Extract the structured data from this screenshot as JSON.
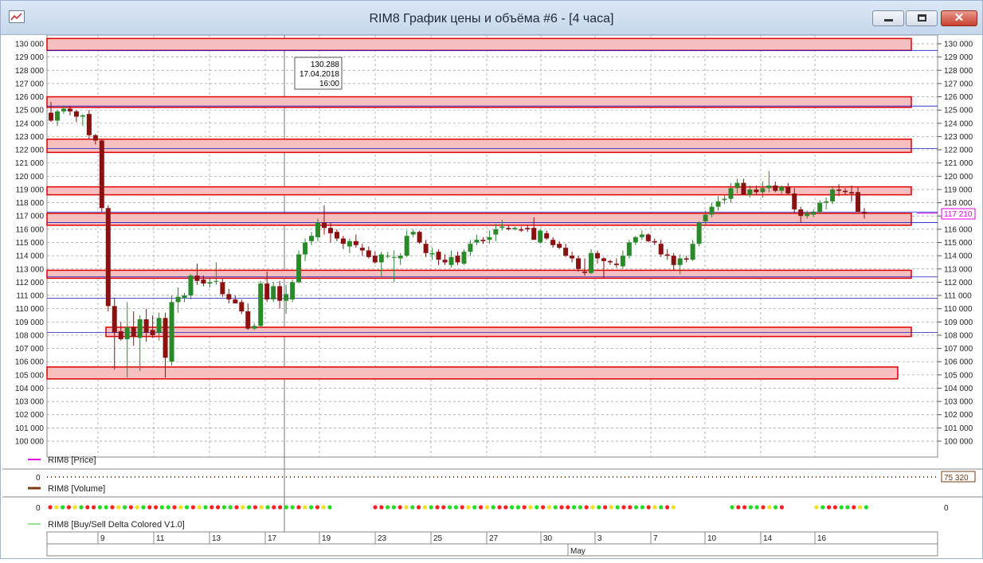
{
  "window": {
    "title": "RIM8 График цены и объёма #6 - [4 часа]",
    "buttons": [
      "minimize",
      "maximize",
      "close"
    ]
  },
  "price_panel": {
    "legend_label": "RIM8 [Price]",
    "y_ticks": [
      "130 000",
      "129 000",
      "128 000",
      "127 000",
      "126 000",
      "125 000",
      "124 000",
      "123 000",
      "122 000",
      "121 000",
      "120 000",
      "119 000",
      "118 000",
      "117 000",
      "116 000",
      "115 000",
      "114 000",
      "113 000",
      "112 000",
      "111 000",
      "110 000",
      "109 000",
      "108 000",
      "107 000",
      "106 000",
      "105 000",
      "104 000",
      "103 000",
      "102 000",
      "101 000",
      "100 000"
    ],
    "current_price_label": "117 210",
    "cursor_tooltip": {
      "price": "130.288",
      "date": "17.04.2018",
      "time": "16:00"
    }
  },
  "volume_panel": {
    "legend_label": "RIM8 [Volume]",
    "y_label": "0",
    "value_label": "75 320"
  },
  "delta_panel": {
    "legend_label": "RIM8 [Buy/Sell Delta Colored V1.0]",
    "y_label_left": "0",
    "y_label_right": "0"
  },
  "x_axis": {
    "day_labels": [
      "9",
      "11",
      "13",
      "17",
      "19",
      "23",
      "25",
      "27",
      "30",
      "3",
      "7",
      "10",
      "14",
      "16"
    ],
    "month_label": "May"
  },
  "colors": {
    "bull": "#2a8a2a",
    "bear": "#8b1010",
    "zone_fill": "#f7c0c0",
    "zone_border": "#e00000",
    "price_line": "#e000e0",
    "level_line": "#1a1acc"
  },
  "chart_data": {
    "type": "candlestick",
    "y_range": [
      99500,
      130500
    ],
    "zones": [
      [
        129500,
        130400
      ],
      [
        125200,
        126000
      ],
      [
        121800,
        122800
      ],
      [
        118600,
        119200
      ],
      [
        116300,
        117200
      ],
      [
        112300,
        112900
      ],
      [
        107900,
        108600
      ],
      [
        104700,
        105600
      ]
    ],
    "blue_levels": [
      129500,
      125300,
      122100,
      117300,
      116500,
      112400,
      110800,
      108200
    ],
    "candles": [
      [
        124800,
        125600,
        124100,
        124200
      ],
      [
        124200,
        125000,
        123800,
        124900
      ],
      [
        124900,
        125300,
        124700,
        125100
      ],
      [
        125100,
        125300,
        124600,
        124900
      ],
      [
        124900,
        125000,
        124100,
        124500
      ],
      [
        124500,
        124700,
        123800,
        124600
      ],
      [
        124700,
        125000,
        122800,
        123100
      ],
      [
        123100,
        123200,
        122400,
        122700
      ],
      [
        122700,
        122800,
        117300,
        117600
      ],
      [
        117600,
        117800,
        109800,
        110200
      ],
      [
        110200,
        110800,
        105400,
        108200
      ],
      [
        108300,
        109000,
        107600,
        107700
      ],
      [
        107700,
        110500,
        104800,
        108600
      ],
      [
        108600,
        109800,
        107200,
        107900
      ],
      [
        107800,
        109500,
        105300,
        109200
      ],
      [
        109200,
        110000,
        107500,
        108200
      ],
      [
        108400,
        109500,
        107800,
        108000
      ],
      [
        108200,
        109700,
        107600,
        109300
      ],
      [
        109300,
        109700,
        104800,
        106300
      ],
      [
        106000,
        111000,
        105700,
        110500
      ],
      [
        110500,
        111600,
        109700,
        110900
      ],
      [
        110800,
        111200,
        110500,
        111000
      ],
      [
        111000,
        112600,
        110700,
        112500
      ],
      [
        112500,
        113400,
        111800,
        112100
      ],
      [
        112200,
        112500,
        111700,
        111900
      ],
      [
        111900,
        112300,
        111600,
        112000
      ],
      [
        112100,
        113500,
        111800,
        112100
      ],
      [
        112000,
        112300,
        110900,
        111100
      ],
      [
        111100,
        111500,
        110400,
        110700
      ],
      [
        110700,
        111000,
        110500,
        110400
      ],
      [
        110500,
        110700,
        109600,
        109800
      ],
      [
        109800,
        110400,
        108400,
        108500
      ],
      [
        108500,
        108900,
        108400,
        108700
      ],
      [
        108700,
        112100,
        108600,
        111900
      ],
      [
        111900,
        112800,
        110500,
        110700
      ],
      [
        110700,
        112000,
        110500,
        111700
      ],
      [
        111700,
        112100,
        110000,
        110600
      ],
      [
        110600,
        111800,
        109600,
        111100
      ],
      [
        110700,
        112200,
        110500,
        112000
      ],
      [
        112000,
        114400,
        111900,
        114100
      ],
      [
        114100,
        115300,
        113600,
        115000
      ],
      [
        115100,
        115800,
        114800,
        115500
      ],
      [
        115400,
        116800,
        115100,
        116500
      ],
      [
        116500,
        117800,
        115600,
        116100
      ],
      [
        116100,
        116500,
        115000,
        115700
      ],
      [
        115800,
        116000,
        115100,
        115300
      ],
      [
        115300,
        115500,
        114500,
        114900
      ],
      [
        114700,
        115300,
        114200,
        115100
      ],
      [
        115100,
        115600,
        114600,
        114800
      ],
      [
        114600,
        114900,
        114000,
        114400
      ],
      [
        114400,
        114700,
        113800,
        113900
      ],
      [
        114000,
        114300,
        113400,
        113500
      ],
      [
        113500,
        114300,
        112400,
        114100
      ],
      [
        114000,
        114300,
        113800,
        114000
      ],
      [
        113900,
        114400,
        112000,
        113900
      ],
      [
        113800,
        114200,
        113300,
        114000
      ],
      [
        114000,
        115900,
        113900,
        115500
      ],
      [
        115600,
        116000,
        115400,
        115800
      ],
      [
        115800,
        115900,
        114900,
        115000
      ],
      [
        114900,
        115200,
        113900,
        114200
      ],
      [
        114100,
        114600,
        113700,
        114200
      ],
      [
        114300,
        114500,
        113300,
        113700
      ],
      [
        113700,
        114100,
        113300,
        113500
      ],
      [
        113300,
        114400,
        113100,
        113900
      ],
      [
        114000,
        114300,
        113300,
        113500
      ],
      [
        113400,
        114500,
        113300,
        114300
      ],
      [
        114300,
        115200,
        114000,
        114900
      ],
      [
        115000,
        115600,
        114800,
        115200
      ],
      [
        115200,
        115400,
        114900,
        115100
      ],
      [
        115200,
        115900,
        114900,
        115400
      ],
      [
        115600,
        116400,
        115100,
        116000
      ],
      [
        116100,
        116700,
        115900,
        116200
      ],
      [
        116100,
        116300,
        115900,
        116000
      ],
      [
        116000,
        116200,
        115900,
        116100
      ],
      [
        116000,
        116200,
        115800,
        115900
      ],
      [
        116100,
        116300,
        115800,
        116000
      ],
      [
        116100,
        116900,
        115200,
        115200
      ],
      [
        115000,
        116000,
        114900,
        115900
      ],
      [
        115700,
        115900,
        115200,
        115300
      ],
      [
        115200,
        115400,
        114600,
        114800
      ],
      [
        114900,
        115100,
        114500,
        114600
      ],
      [
        114600,
        114900,
        113900,
        114000
      ],
      [
        114000,
        114300,
        113500,
        113800
      ],
      [
        113800,
        114000,
        112800,
        113000
      ],
      [
        112800,
        113800,
        112500,
        112700
      ],
      [
        112700,
        114500,
        112600,
        114200
      ],
      [
        114200,
        114400,
        113400,
        113800
      ],
      [
        113800,
        113900,
        112300,
        113600
      ],
      [
        113600,
        113700,
        113300,
        113500
      ],
      [
        113400,
        113800,
        113100,
        113300
      ],
      [
        113200,
        114400,
        113000,
        114000
      ],
      [
        114000,
        115200,
        113800,
        115000
      ],
      [
        115000,
        115500,
        114800,
        115400
      ],
      [
        115400,
        115900,
        115200,
        115600
      ],
      [
        115600,
        115700,
        115000,
        115100
      ],
      [
        115100,
        115300,
        114800,
        115000
      ],
      [
        114900,
        115200,
        113900,
        114100
      ],
      [
        114100,
        114500,
        113700,
        114000
      ],
      [
        114000,
        114200,
        112900,
        113300
      ],
      [
        113300,
        114100,
        112600,
        113800
      ],
      [
        113800,
        114000,
        113500,
        113700
      ],
      [
        113700,
        115200,
        113600,
        114900
      ],
      [
        114900,
        116600,
        114700,
        116500
      ],
      [
        116600,
        117400,
        116300,
        117100
      ],
      [
        117100,
        118000,
        116900,
        117700
      ],
      [
        117700,
        118500,
        117400,
        118100
      ],
      [
        118200,
        118600,
        117900,
        118300
      ],
      [
        118300,
        119500,
        118000,
        119100
      ],
      [
        119100,
        119800,
        118700,
        119500
      ],
      [
        119500,
        119800,
        118600,
        118600
      ],
      [
        118600,
        119300,
        118400,
        119000
      ],
      [
        119000,
        119300,
        118600,
        118800
      ],
      [
        118800,
        119600,
        118400,
        119100
      ],
      [
        119100,
        120400,
        118800,
        119300
      ],
      [
        119300,
        119600,
        118800,
        118900
      ],
      [
        118900,
        119300,
        118600,
        119200
      ],
      [
        119200,
        119500,
        118600,
        118700
      ],
      [
        118700,
        119100,
        117200,
        117500
      ],
      [
        117500,
        117700,
        116500,
        117000
      ],
      [
        117000,
        117400,
        116800,
        117200
      ],
      [
        117100,
        117500,
        116900,
        117300
      ],
      [
        117300,
        118200,
        117200,
        118000
      ],
      [
        118000,
        118400,
        117500,
        118100
      ],
      [
        118100,
        119200,
        117900,
        119000
      ],
      [
        119000,
        119400,
        118500,
        118900
      ],
      [
        118900,
        119100,
        118600,
        118800
      ],
      [
        118800,
        119300,
        118100,
        118700
      ],
      [
        118800,
        119200,
        117300,
        117300
      ],
      [
        117300,
        117600,
        116800,
        117200
      ]
    ],
    "volume_value": 75320,
    "delta_dots": []
  }
}
